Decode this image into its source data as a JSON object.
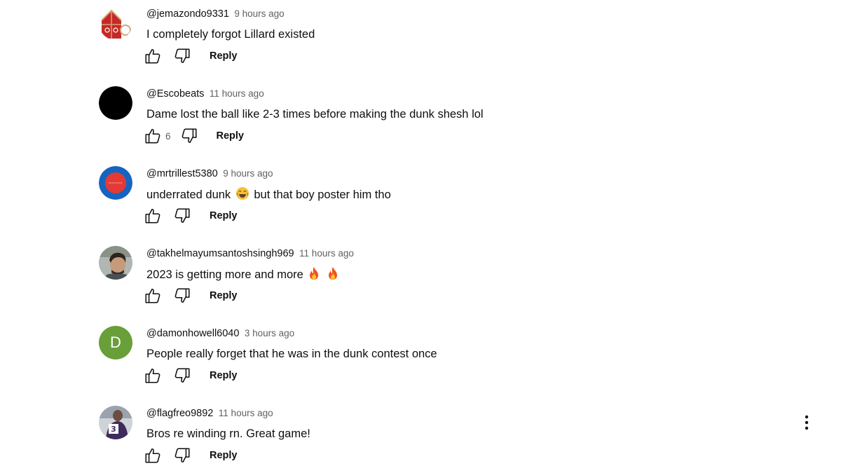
{
  "comments": [
    {
      "author": "@jemazondo9331",
      "time": "9 hours ago",
      "text": "I completely forgot Lillard existed",
      "like_count": "",
      "reply_label": "Reply",
      "avatar": "logo-avatar"
    },
    {
      "author": "@Escobeats",
      "time": "11 hours ago",
      "text": "Dame lost the ball like 2-3 times before making the dunk shesh lol",
      "like_count": "6",
      "reply_label": "Reply",
      "avatar": "black-circle-avatar"
    },
    {
      "author": "@mrtrillest5380",
      "time": "9 hours ago",
      "text_before": "underrated dunk",
      "emoji": "laughing-emoji",
      "text_after": "but that boy poster him tho",
      "like_count": "",
      "reply_label": "Reply",
      "avatar": "blue-red-ring-avatar"
    },
    {
      "author": "@takhelmayumsantoshsingh969",
      "time": "11 hours ago",
      "text": "2023 is getting more and more",
      "emoji": "fire-emoji",
      "like_count": "",
      "reply_label": "Reply",
      "avatar": "photo-avatar"
    },
    {
      "author": "@damonhowell6040",
      "time": "3 hours ago",
      "text": "People really forget that he was in the dunk contest once",
      "like_count": "",
      "reply_label": "Reply",
      "avatar_letter": "D",
      "avatar": "letter-avatar"
    },
    {
      "author": "@flagfreo9892",
      "time": "11 hours ago",
      "text": "Bros re winding rn. Great game!",
      "like_count": "",
      "reply_label": "Reply",
      "avatar": "jersey-photo-avatar"
    }
  ],
  "colors": {
    "author": "#0f0f0f",
    "time": "#606060",
    "text": "#0f0f0f",
    "letter_avatar_bg": "#689f38",
    "ring_avatar_blue": "#1565c0",
    "ring_avatar_red": "#e53935"
  },
  "icons": {
    "like": "thumbs-up-icon",
    "dislike": "thumbs-down-icon",
    "more": "more-vertical-icon"
  }
}
